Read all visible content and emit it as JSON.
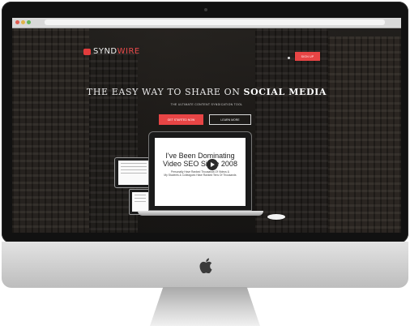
{
  "site": {
    "logo_main": "SYND",
    "logo_accent": "WIRE",
    "nav_button": "SIGN UP",
    "headline_light": "THE EASY WAY TO SHARE ON",
    "headline_bold": "SOCIAL MEDIA",
    "subline": "THE ULTIMATE CONTENT SYNDICATION TOOL",
    "cta_primary": "GET STARTED NOW",
    "cta_secondary": "LEARN MORE"
  },
  "video": {
    "title_line1": "I've Been Dominating",
    "title_line2": "Video SEO Since 2008",
    "sub_line1": "Personally Have Ranked Thousands Of Videos &",
    "sub_line2": "My Students & Colleagues Have Ranked Tens Of Thousands"
  },
  "colors": {
    "accent": "#e84545",
    "bezel": "#111111",
    "chin": "#d0d0d0"
  },
  "icons": [
    "apple-logo-icon",
    "play-icon",
    "logo-mark-icon"
  ]
}
